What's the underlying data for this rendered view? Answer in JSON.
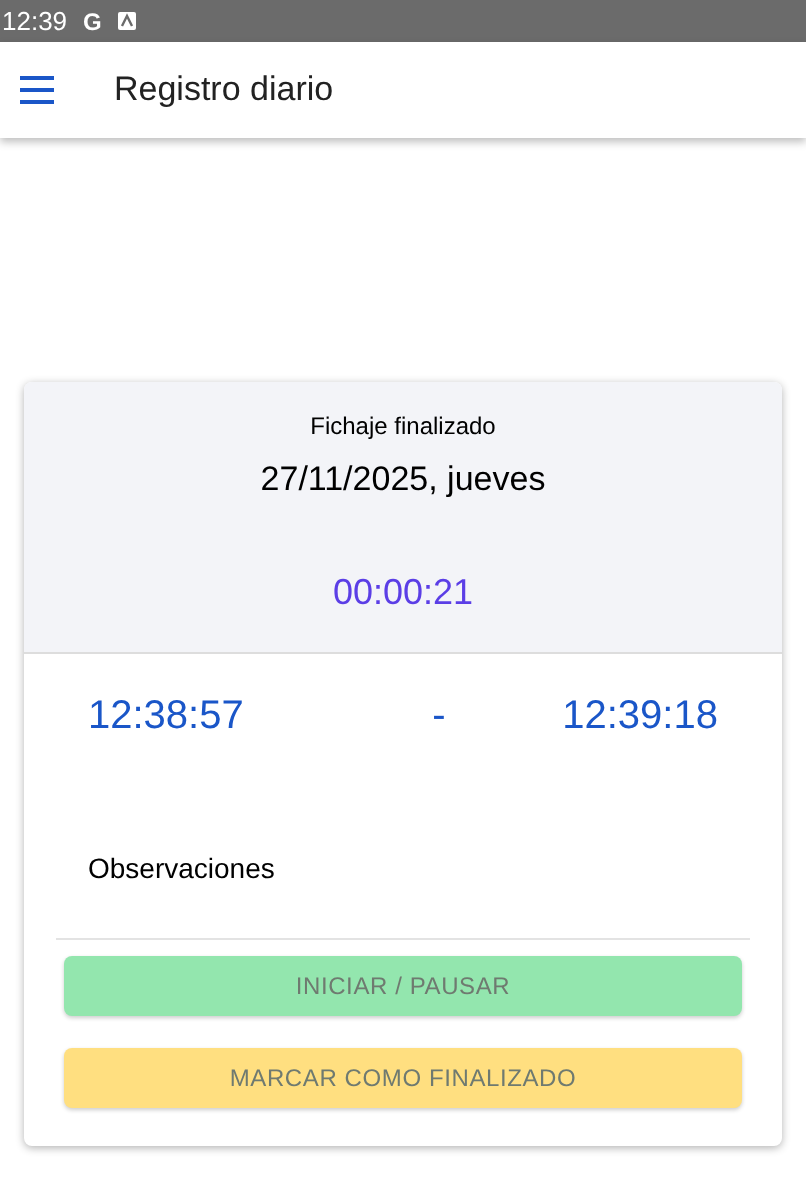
{
  "status_bar": {
    "time": "12:39",
    "icons": [
      "G"
    ]
  },
  "app_bar": {
    "title": "Registro diario"
  },
  "card": {
    "status": "Fichaje finalizado",
    "date": "27/11/2025, jueves",
    "duration": "00:00:21",
    "start_time": "12:38:57",
    "separator": "-",
    "end_time": "12:39:18",
    "notes": {
      "placeholder": "Observaciones"
    },
    "buttons": [
      {
        "label": "INICIAR / PAUSAR",
        "kind": "start",
        "disabled": true
      },
      {
        "label": "MARCAR COMO FINALIZADO",
        "kind": "finish",
        "disabled": true
      }
    ]
  }
}
